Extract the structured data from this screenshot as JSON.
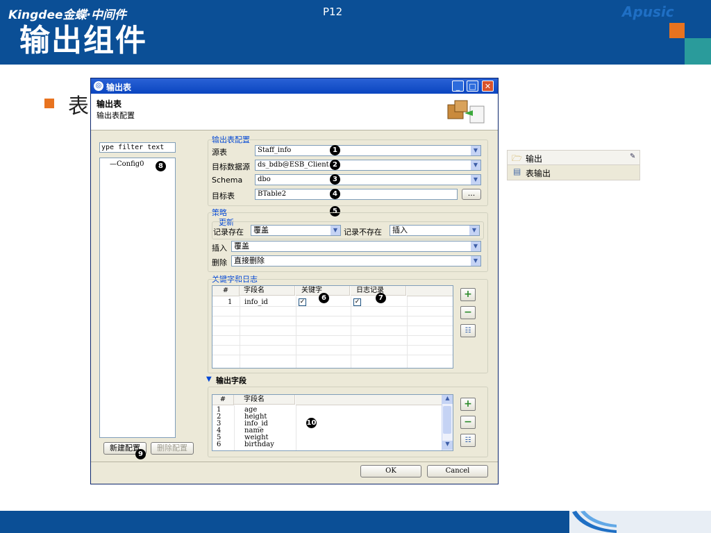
{
  "slide": {
    "title": "输出组件",
    "bullet": "表",
    "page": "P12",
    "logo_left": "Kingdee金蝶·中间件",
    "logo_right": "Apusic"
  },
  "dialog": {
    "title": "输出表",
    "banner_title": "输出表",
    "banner_subtitle": "输出表配置",
    "filter_placeholder": "ype filter text",
    "tree_item": "Config0",
    "new_config": "新建配置",
    "delete_config": "删除配置",
    "ok": "OK",
    "cancel": "Cancel",
    "output_config": {
      "group_title": "输出表配置",
      "source_label": "源表",
      "source_value": "Staff_info",
      "datasource_label": "目标数据源",
      "datasource_value": "ds_bdb@ESB_Client",
      "schema_label": "Schema",
      "schema_value": "dbo",
      "target_label": "目标表",
      "target_value": "BTable2",
      "browse": "..."
    },
    "strategy": {
      "group_title": "策略",
      "update_title": "更新",
      "exists_label": "记录存在",
      "exists_value": "覆盖",
      "not_exists_label": "记录不存在",
      "not_exists_value": "插入",
      "insert_label": "插入",
      "insert_value": "覆盖",
      "delete_label": "删除",
      "delete_value": "直接删除"
    },
    "keys": {
      "group_title": "关键字和日志",
      "col_num": "#",
      "col_field": "字段名",
      "col_key": "关键字",
      "col_log": "日志记录",
      "rows": [
        {
          "num": "1",
          "field": "info_id",
          "key": "✓",
          "log": "✓"
        }
      ]
    },
    "fields": {
      "section_title": "输出字段",
      "col_num": "#",
      "col_field": "字段名",
      "rows": [
        {
          "num": "1",
          "field": "age"
        },
        {
          "num": "2",
          "field": "height"
        },
        {
          "num": "3",
          "field": "info_id"
        },
        {
          "num": "4",
          "field": "name"
        },
        {
          "num": "5",
          "field": "weight"
        },
        {
          "num": "6",
          "field": "birthday"
        }
      ]
    },
    "badges": [
      "1",
      "2",
      "3",
      "4",
      "5",
      "6",
      "7",
      "8",
      "9",
      "10"
    ]
  },
  "side_panel": {
    "item1": "输出",
    "item2": "表输出"
  },
  "colors": {
    "header_blue": "#0b4f96",
    "accent_orange": "#e8731f",
    "accent_teal": "#2a9b9b"
  }
}
